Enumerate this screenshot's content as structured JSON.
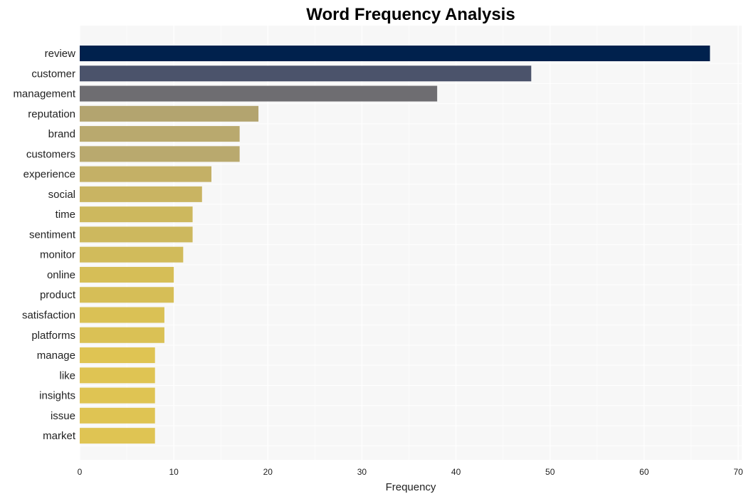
{
  "chart_data": {
    "type": "bar",
    "orientation": "horizontal",
    "title": "Word Frequency Analysis",
    "xlabel": "Frequency",
    "ylabel": "",
    "xlim": [
      0,
      70
    ],
    "xticks": [
      0,
      10,
      20,
      30,
      40,
      50,
      60,
      70
    ],
    "grid": true,
    "legend": "none",
    "categories": [
      "review",
      "customer",
      "management",
      "reputation",
      "brand",
      "customers",
      "experience",
      "social",
      "time",
      "sentiment",
      "monitor",
      "online",
      "product",
      "satisfaction",
      "platforms",
      "manage",
      "like",
      "insights",
      "issue",
      "market"
    ],
    "values": [
      67,
      48,
      38,
      19,
      17,
      17,
      14,
      13,
      12,
      12,
      11,
      10,
      10,
      9,
      9,
      8,
      8,
      8,
      8,
      8
    ],
    "colors": [
      "#00214d",
      "#4b536b",
      "#6e6d71",
      "#b3a46f",
      "#b9a96e",
      "#b9a96e",
      "#c4b066",
      "#c9b462",
      "#cdb85e",
      "#cdb85e",
      "#d1bb5b",
      "#d6be57",
      "#d6be57",
      "#dac155",
      "#dac155",
      "#dfc453",
      "#dfc453",
      "#dfc453",
      "#dfc453",
      "#dfc453"
    ],
    "background": "#f7f7f7"
  }
}
